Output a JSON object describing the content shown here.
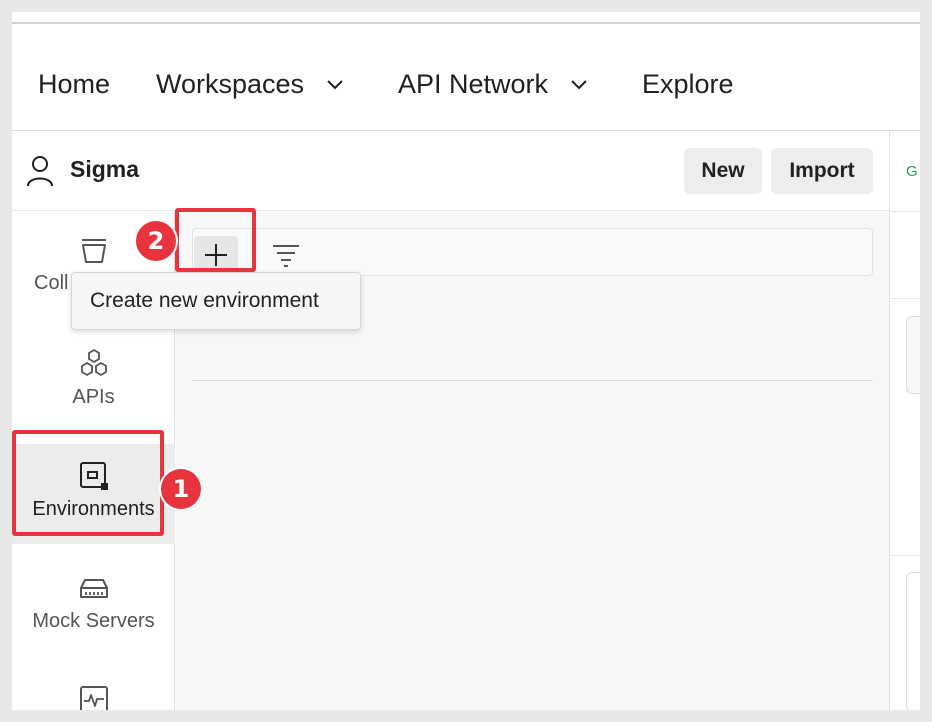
{
  "nav": {
    "home": "Home",
    "workspaces": "Workspaces",
    "api_network": "API Network",
    "explore": "Explore"
  },
  "workspace": {
    "name": "Sigma",
    "new_label": "New",
    "import_label": "Import"
  },
  "sidebar": {
    "items": [
      {
        "label": "Coll",
        "icon": "collections-icon"
      },
      {
        "label": "APIs",
        "icon": "apis-icon"
      },
      {
        "label": "Environments",
        "icon": "environments-icon",
        "active": true
      },
      {
        "label": "Mock Servers",
        "icon": "mock-servers-icon"
      },
      {
        "label": "",
        "icon": "monitors-icon"
      }
    ]
  },
  "tooltip": {
    "text": "Create new environment"
  },
  "annotations": {
    "step1": "1",
    "step2": "2"
  },
  "right_panel": {
    "fragment": "G"
  },
  "colors": {
    "highlight": "#e8343f",
    "accent_green": "#2e9e4a"
  }
}
